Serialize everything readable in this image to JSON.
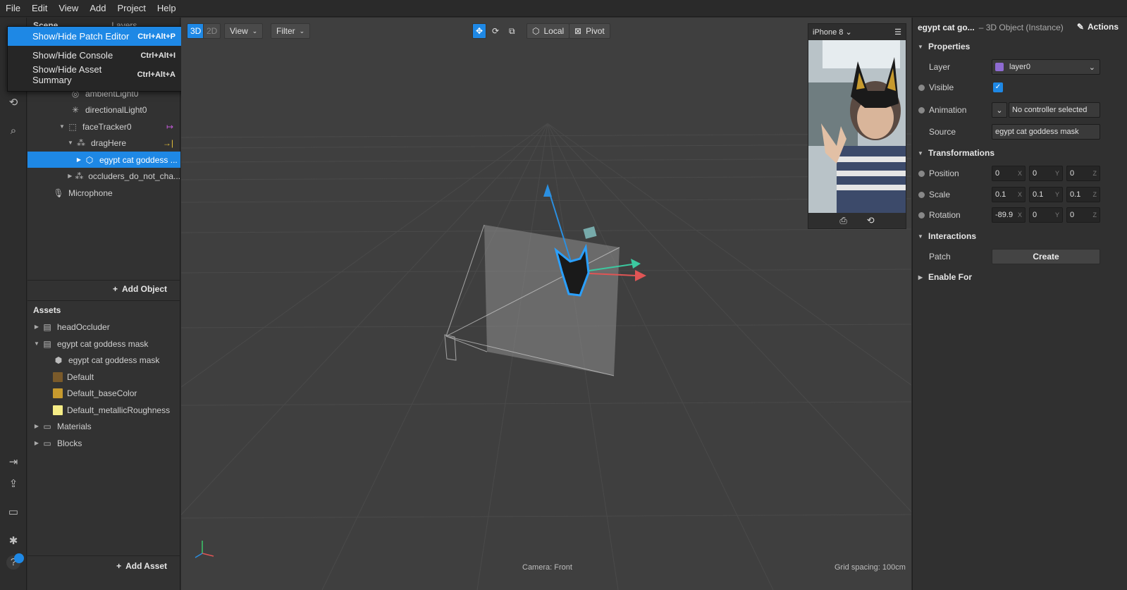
{
  "menu": [
    "File",
    "Edit",
    "View",
    "Add",
    "Project",
    "Help"
  ],
  "dropdown": [
    {
      "label": "Show/Hide Patch Editor",
      "shortcut": "Ctrl+Alt+P"
    },
    {
      "label": "Show/Hide Console",
      "shortcut": "Ctrl+Alt+I"
    },
    {
      "label": "Show/Hide Asset Summary",
      "shortcut": "Ctrl+Alt+A"
    }
  ],
  "scene": {
    "tabs": [
      "Scene",
      "Layers"
    ],
    "items": [
      {
        "label": "ambientLight0",
        "icon": "ambient-light-icon",
        "badge": ""
      },
      {
        "label": "directionalLight0",
        "icon": "directional-light-icon",
        "badge": ""
      },
      {
        "label": "faceTracker0",
        "icon": "face-tracker-icon",
        "badge": "↦"
      },
      {
        "label": "dragHere",
        "icon": "null-object-icon",
        "badge": "→|"
      },
      {
        "label": "egypt cat goddess ...",
        "icon": "mesh-icon",
        "badge": ""
      },
      {
        "label": "occluders_do_not_cha...",
        "icon": "null-object-icon",
        "badge": ""
      },
      {
        "label": "Microphone",
        "icon": "microphone-icon",
        "badge": ""
      }
    ],
    "add_object": "Add Object"
  },
  "assets": {
    "title": "Assets",
    "items": [
      {
        "label": "headOccluder"
      },
      {
        "label": "egypt cat goddess mask"
      },
      {
        "label": "egypt cat goddess mask"
      },
      {
        "label": "Default"
      },
      {
        "label": "Default_baseColor"
      },
      {
        "label": "Default_metallicRoughness"
      },
      {
        "label": "Materials"
      },
      {
        "label": "Blocks"
      }
    ],
    "add_asset": "Add Asset"
  },
  "viewport": {
    "mode_3d": "3D",
    "mode_2d": "2D",
    "view": "View",
    "filter": "Filter",
    "local": "Local",
    "pivot": "Pivot",
    "camera": "Camera: Front",
    "grid": "Grid spacing: 100cm"
  },
  "preview": {
    "device": "iPhone 8"
  },
  "inspector": {
    "object_name": "egypt cat go...",
    "object_type": "– 3D Object (Instance)",
    "actions": "Actions",
    "properties": "Properties",
    "layer_label": "Layer",
    "layer_value": "layer0",
    "visible_label": "Visible",
    "animation_label": "Animation",
    "animation_value": "No controller selected",
    "source_label": "Source",
    "source_value": "egypt cat goddess mask",
    "transformations": "Transformations",
    "position_label": "Position",
    "position": [
      "0",
      "0",
      "0"
    ],
    "scale_label": "Scale",
    "scale": [
      "0.1",
      "0.1",
      "0.1"
    ],
    "rotation_label": "Rotation",
    "rotation": [
      "-89.9",
      "0",
      "0"
    ],
    "interactions": "Interactions",
    "patch_label": "Patch",
    "create": "Create",
    "enable_for": "Enable For"
  },
  "colors": {
    "accent": "#1e88e5",
    "layer_swatch": "#8e6bd1",
    "tracker_badge": "#c05ad6",
    "drag_badge": "#e6c23a"
  }
}
